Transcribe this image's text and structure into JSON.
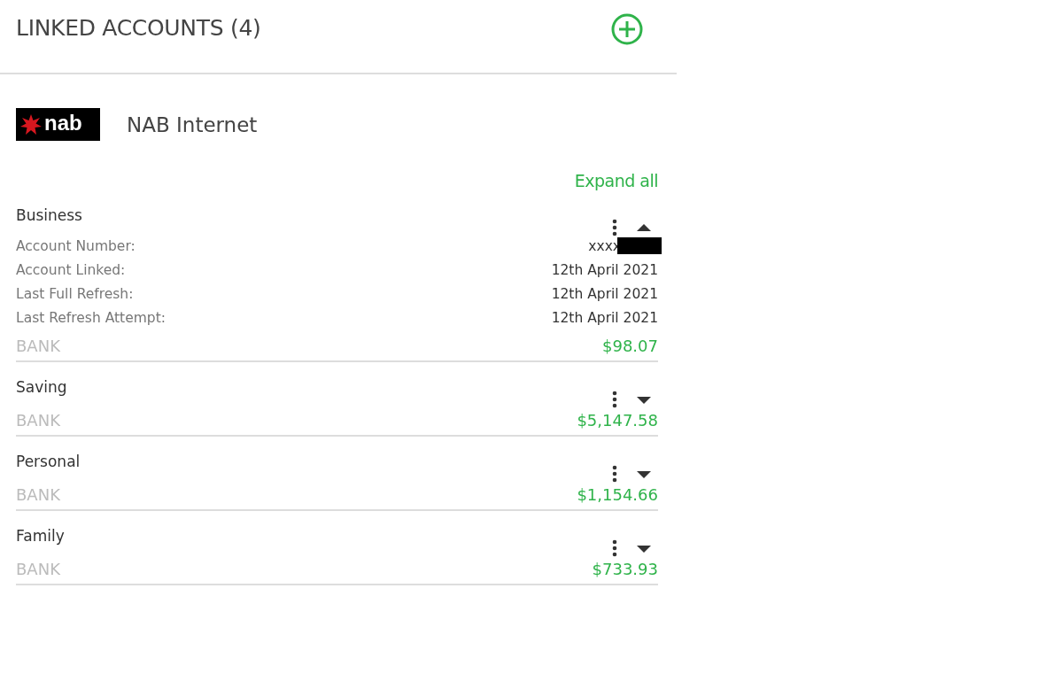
{
  "header": {
    "title": "LINKED ACCOUNTS (4)"
  },
  "provider": {
    "logo_text": "nab",
    "name": "NAB Internet"
  },
  "expand_all": "Expand all",
  "accounts": [
    {
      "name": "Business",
      "expanded": true,
      "details": [
        {
          "label": "Account Number:",
          "value": "xxxx",
          "redacted": true
        },
        {
          "label": "Account Linked:",
          "value": "12th April 2021",
          "redacted": false
        },
        {
          "label": "Last Full Refresh:",
          "value": "12th April 2021",
          "redacted": false
        },
        {
          "label": "Last Refresh Attempt:",
          "value": "12th April 2021",
          "redacted": false
        }
      ],
      "type": "BANK",
      "balance": "$98.07"
    },
    {
      "name": "Saving",
      "expanded": false,
      "type": "BANK",
      "balance": "$5,147.58"
    },
    {
      "name": "Personal",
      "expanded": false,
      "type": "BANK",
      "balance": "$1,154.66"
    },
    {
      "name": "Family",
      "expanded": false,
      "type": "BANK",
      "balance": "$733.93"
    }
  ]
}
